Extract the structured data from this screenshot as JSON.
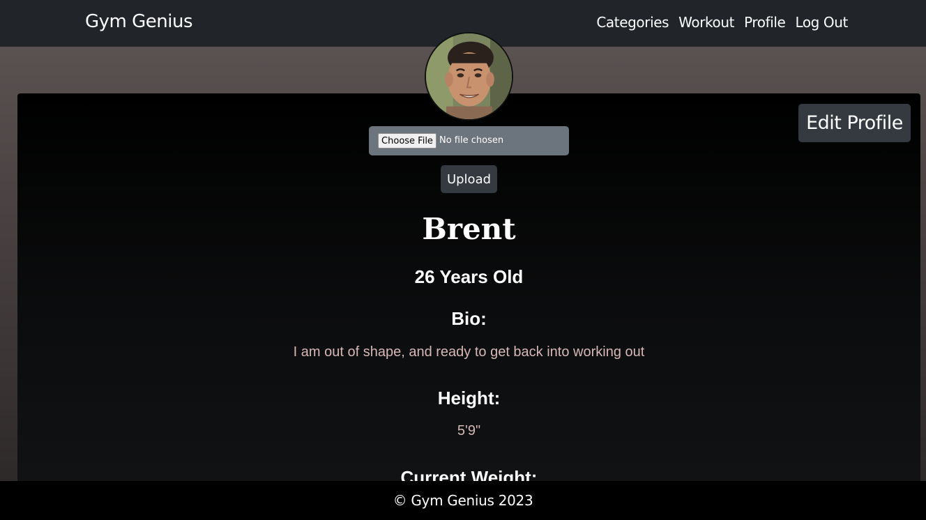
{
  "navbar": {
    "brand": "Gym Genius",
    "links": [
      "Categories",
      "Workout",
      "Profile",
      "Log Out"
    ]
  },
  "profile": {
    "edit_button": "Edit Profile",
    "file_input": {
      "button_label": "Choose File",
      "status": "No file chosen"
    },
    "upload_button": "Upload",
    "name": "Brent",
    "age": "26 Years Old",
    "bio_label": "Bio:",
    "bio": "I am out of shape, and ready to get back into working out",
    "height_label": "Height:",
    "height": "5'9\"",
    "weight_label": "Current Weight:"
  },
  "footer": {
    "text": "© Gym Genius 2023"
  }
}
